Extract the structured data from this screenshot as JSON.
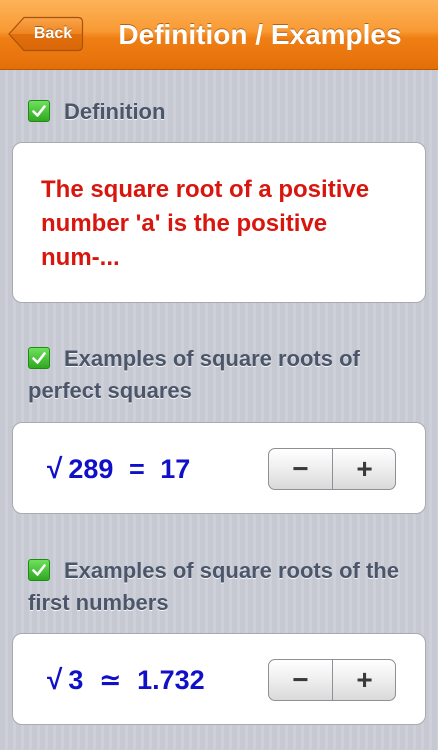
{
  "navbar": {
    "back_label": "Back",
    "title": "Definition / Examples",
    "color": "#f38a22"
  },
  "definition": {
    "header": "Definition",
    "text": "The square root of a positive number 'a' is the positive num-...",
    "text_color": "#d8160e"
  },
  "perfect_squares": {
    "header": "Examples of square roots of perfect squares",
    "radicand": "289",
    "relation": "=",
    "result": "17",
    "minus_label": "−",
    "plus_label": "+"
  },
  "first_numbers": {
    "header": "Examples of square roots of the first numbers",
    "radicand": "3",
    "relation": "≃",
    "result": "1.732",
    "minus_label": "−",
    "plus_label": "+"
  },
  "icons": {
    "check": "check-icon",
    "sqrt_symbol": "√"
  },
  "expression_color": "#1010c8"
}
